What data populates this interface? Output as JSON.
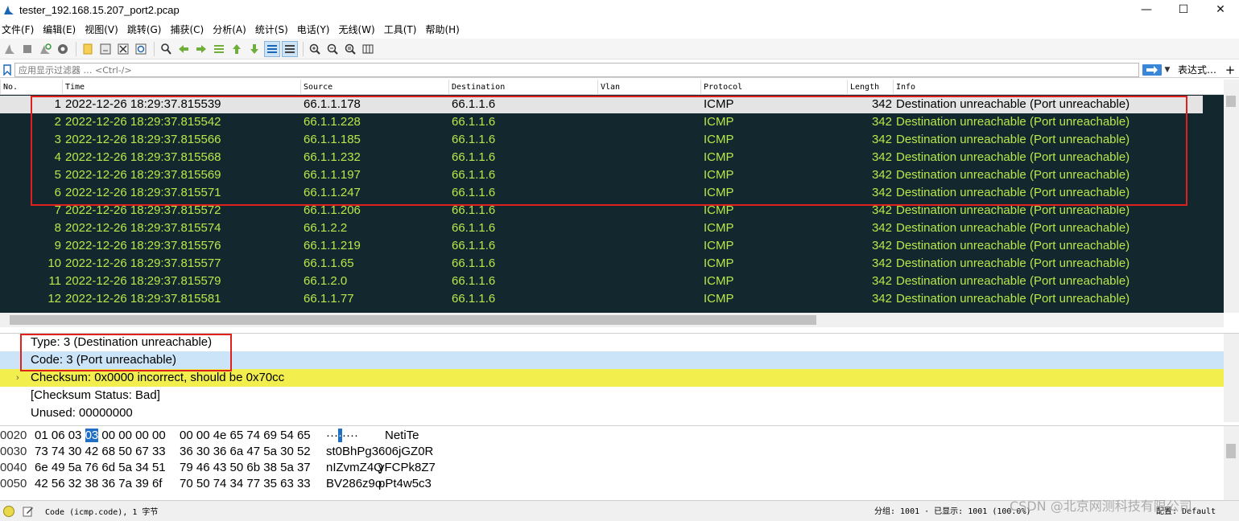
{
  "window": {
    "title": "tester_192.168.15.207_port2.pcap",
    "minimize": "—",
    "maximize": "☐",
    "close": "✕"
  },
  "menu": [
    "文件(F)",
    "编辑(E)",
    "视图(V)",
    "跳转(G)",
    "捕获(C)",
    "分析(A)",
    "统计(S)",
    "电话(Y)",
    "无线(W)",
    "工具(T)",
    "帮助(H)"
  ],
  "toolbar": {
    "icons": [
      "shark-fin-start-icon",
      "stop-icon",
      "restart-icon",
      "options-gear-icon",
      "open-file-icon",
      "save-file-icon",
      "close-file-icon",
      "reload-icon",
      "find-icon",
      "go-back-icon",
      "go-forward-icon",
      "go-to-packet-icon",
      "go-first-icon",
      "go-last-icon",
      "autoscroll-icon",
      "colorize-icon",
      "zoom-in-icon",
      "zoom-out-icon",
      "zoom-reset-icon",
      "resize-columns-icon"
    ]
  },
  "filter": {
    "placeholder": "应用显示过滤器 … <Ctrl-/>",
    "expression_button": "表达式…",
    "add_button": "+"
  },
  "packet_list": {
    "columns": [
      "No.",
      "Time",
      "Source",
      "Destination",
      "Vlan",
      "Protocol",
      "Length",
      "Info"
    ],
    "rows": [
      {
        "no": "1",
        "time": "2022-12-26 18:29:37.815539",
        "src": "66.1.1.178",
        "dst": "66.1.1.6",
        "proto": "ICMP",
        "len": "342",
        "info": "Destination unreachable (Port unreachable)"
      },
      {
        "no": "2",
        "time": "2022-12-26 18:29:37.815542",
        "src": "66.1.1.228",
        "dst": "66.1.1.6",
        "proto": "ICMP",
        "len": "342",
        "info": "Destination unreachable (Port unreachable)"
      },
      {
        "no": "3",
        "time": "2022-12-26 18:29:37.815566",
        "src": "66.1.1.185",
        "dst": "66.1.1.6",
        "proto": "ICMP",
        "len": "342",
        "info": "Destination unreachable (Port unreachable)"
      },
      {
        "no": "4",
        "time": "2022-12-26 18:29:37.815568",
        "src": "66.1.1.232",
        "dst": "66.1.1.6",
        "proto": "ICMP",
        "len": "342",
        "info": "Destination unreachable (Port unreachable)"
      },
      {
        "no": "5",
        "time": "2022-12-26 18:29:37.815569",
        "src": "66.1.1.197",
        "dst": "66.1.1.6",
        "proto": "ICMP",
        "len": "342",
        "info": "Destination unreachable (Port unreachable)"
      },
      {
        "no": "6",
        "time": "2022-12-26 18:29:37.815571",
        "src": "66.1.1.247",
        "dst": "66.1.1.6",
        "proto": "ICMP",
        "len": "342",
        "info": "Destination unreachable (Port unreachable)"
      },
      {
        "no": "7",
        "time": "2022-12-26 18:29:37.815572",
        "src": "66.1.1.206",
        "dst": "66.1.1.6",
        "proto": "ICMP",
        "len": "342",
        "info": "Destination unreachable (Port unreachable)"
      },
      {
        "no": "8",
        "time": "2022-12-26 18:29:37.815574",
        "src": "66.1.2.2",
        "dst": "66.1.1.6",
        "proto": "ICMP",
        "len": "342",
        "info": "Destination unreachable (Port unreachable)"
      },
      {
        "no": "9",
        "time": "2022-12-26 18:29:37.815576",
        "src": "66.1.1.219",
        "dst": "66.1.1.6",
        "proto": "ICMP",
        "len": "342",
        "info": "Destination unreachable (Port unreachable)"
      },
      {
        "no": "10",
        "time": "2022-12-26 18:29:37.815577",
        "src": "66.1.1.65",
        "dst": "66.1.1.6",
        "proto": "ICMP",
        "len": "342",
        "info": "Destination unreachable (Port unreachable)"
      },
      {
        "no": "11",
        "time": "2022-12-26 18:29:37.815579",
        "src": "66.1.2.0",
        "dst": "66.1.1.6",
        "proto": "ICMP",
        "len": "342",
        "info": "Destination unreachable (Port unreachable)"
      },
      {
        "no": "12",
        "time": "2022-12-26 18:29:37.815581",
        "src": "66.1.1.77",
        "dst": "66.1.1.6",
        "proto": "ICMP",
        "len": "342",
        "info": "Destination unreachable (Port unreachable)"
      }
    ]
  },
  "details": {
    "rows": [
      {
        "text": "Type: 3 (Destination unreachable)",
        "style": "normal",
        "expander": ""
      },
      {
        "text": "Code: 3 (Port unreachable)",
        "style": "selected",
        "expander": ""
      },
      {
        "text": "Checksum: 0x0000 incorrect, should be 0x70cc",
        "style": "warning",
        "expander": "›"
      },
      {
        "text": "[Checksum Status: Bad]",
        "style": "normal",
        "expander": ""
      },
      {
        "text": "Unused: 00000000",
        "style": "normal",
        "expander": ""
      }
    ]
  },
  "bytes": {
    "rows": [
      {
        "offset": "0020",
        "hex1_pre": "01 06 03 ",
        "hex1_hl": "03",
        "hex1_post": " 00 00 00 00",
        "hex2": "00 00 4e 65 74 69 54 65",
        "asc1_pre": "···",
        "asc1_hl": "·",
        "asc1_post": "····",
        "asc2": "NetiTe"
      },
      {
        "offset": "0030",
        "hex1_pre": "73 74 30 42 68 50 67 33",
        "hex1_hl": "",
        "hex1_post": "",
        "hex2": "36 30 36 6a 47 5a 30 52",
        "asc1_pre": "st0BhPg3",
        "asc1_hl": "",
        "asc1_post": "",
        "asc2": "606jGZ0R"
      },
      {
        "offset": "0040",
        "hex1_pre": "6e 49 5a 76 6d 5a 34 51",
        "hex1_hl": "",
        "hex1_post": "",
        "hex2": "79 46 43 50 6b 38 5a 37",
        "asc1_pre": "nIZvmZ4Q",
        "asc1_hl": "",
        "asc1_post": "",
        "asc2": "yFCPk8Z7"
      },
      {
        "offset": "0050",
        "hex1_pre": "42 56 32 38 36 7a 39 6f",
        "hex1_hl": "",
        "hex1_post": "",
        "hex2": "70 50 74 34 77 35 63 33",
        "asc1_pre": "BV286z9o",
        "asc1_hl": "",
        "asc1_post": "",
        "asc2": "pPt4w5c3"
      }
    ]
  },
  "status": {
    "field_info": "Code (icmp.code), 1 字节",
    "stats": "分组: 1001 · 已显示: 1001 (100.0%)",
    "profile": "配置: Default",
    "watermark": "CSDN @北京网测科技有限公司"
  },
  "colors": {
    "packet_bg": "#12272e",
    "packet_fg": "#b6e84a",
    "selected_bg": "#e4e4e4",
    "detail_selected": "#cce4f7",
    "detail_warning": "#f1ee4e",
    "highlight_box": "#e0201d",
    "byte_highlight": "#1f6fc5"
  }
}
